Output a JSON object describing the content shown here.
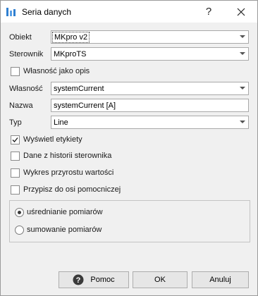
{
  "window": {
    "title": "Seria danych",
    "help_glyph": "?"
  },
  "fields": {
    "obiekt": {
      "label": "Obiekt",
      "value": "MKpro v2"
    },
    "sterownik": {
      "label": "Sterownik",
      "value": "MKproTS"
    },
    "wlasnosc": {
      "label": "Własność",
      "value": "systemCurrent"
    },
    "nazwa": {
      "label": "Nazwa",
      "value": "systemCurrent [A]"
    },
    "typ": {
      "label": "Typ",
      "value": "Line"
    }
  },
  "checkboxes": {
    "wlasnosc_jako_opis": {
      "label": "Własność jako opis",
      "checked": false
    },
    "wyswietl_etykiety": {
      "label": "Wyświetl etykiety",
      "checked": true
    },
    "dane_z_historii": {
      "label": "Dane z historii sterownika",
      "checked": false
    },
    "wykres_przyrostu": {
      "label": "Wykres przyrostu wartości",
      "checked": false
    },
    "przypisz_do_osi": {
      "label": "Przypisz do osi pomocniczej",
      "checked": false
    }
  },
  "radios": {
    "usrednianie": {
      "label": "uśrednianie pomiarów",
      "selected": true
    },
    "sumowanie": {
      "label": "sumowanie pomiarów",
      "selected": false
    }
  },
  "buttons": {
    "help": "Pomoc",
    "ok": "OK",
    "cancel": "Anuluj"
  },
  "colors": {
    "accent_icon": "#2f7fd0",
    "checkmark": "#1a1a1a"
  }
}
